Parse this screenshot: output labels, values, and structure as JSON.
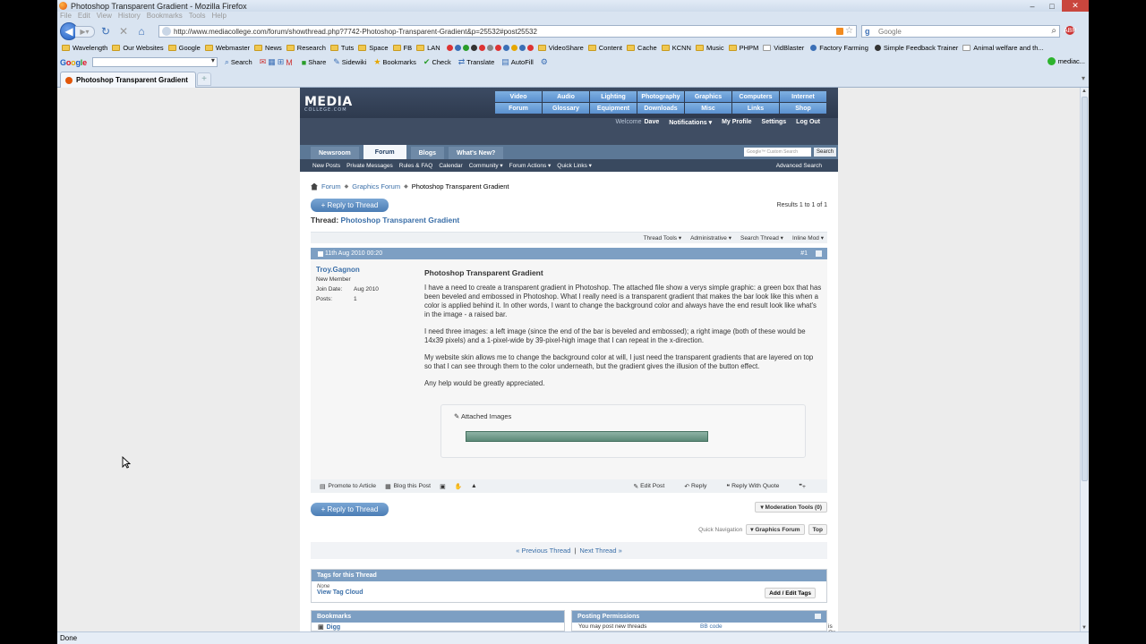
{
  "browser": {
    "window_title": "Photoshop Transparent Gradient - Mozilla Firefox",
    "menu": [
      "File",
      "Edit",
      "View",
      "History",
      "Bookmarks",
      "Tools",
      "Help"
    ],
    "url": "http://www.mediacollege.com/forum/showthread.php?7742-Photoshop-Transparent-Gradient&p=25532#post25532",
    "search_placeholder": "Google",
    "bookmarks": [
      "Wavelength",
      "Our Websites",
      "Google",
      "Webmaster",
      "News",
      "Research",
      "Tuts",
      "Space",
      "FB",
      "LAN",
      "VideoShare",
      "Content",
      "Cache",
      "KCNN",
      "Music",
      "PHPM",
      "VidBlaster",
      "Factory Farming",
      "Simple Feedback Trainer",
      "Animal welfare and th..."
    ],
    "google_toolbar": {
      "logo": [
        "G",
        "o",
        "o",
        "g",
        "l",
        "e"
      ],
      "items": [
        "Search",
        "Share",
        "Sidewiki",
        "Bookmarks",
        "Check",
        "Translate",
        "AutoFill"
      ],
      "right": "mediac..."
    },
    "tab_title": "Photoshop Transparent Gradient",
    "status": "Done"
  },
  "site": {
    "logo": "MEDIA",
    "logo_sub": "COLLEGE.COM",
    "nav_grid": [
      "Video",
      "Audio",
      "Lighting",
      "Photography",
      "Graphics",
      "Computers",
      "Internet",
      "Forum",
      "Glossary",
      "Equipment",
      "Downloads",
      "Misc",
      "Links",
      "Shop"
    ],
    "user_bar": {
      "welcome": "Welcome",
      "user": "Dave",
      "notifications": "Notifications ▾",
      "profile": "My Profile",
      "settings": "Settings",
      "logout": "Log Out"
    },
    "tabs": [
      "Newsroom",
      "Forum",
      "Blogs",
      "What's New?"
    ],
    "search_placeholder": "Google™ Custom Search",
    "search_btn": "Search",
    "subnav": [
      "New Posts",
      "Private Messages",
      "Rules & FAQ",
      "Calendar",
      "Community ▾",
      "Forum Actions ▾",
      "Quick Links ▾"
    ],
    "advanced_search": "Advanced Search"
  },
  "breadcrumb": {
    "forum": "Forum",
    "graphics": "Graphics Forum",
    "current": "Photoshop Transparent Gradient"
  },
  "reply_label": "+ Reply to Thread",
  "results": "Results 1 to 1 of 1",
  "thread": {
    "label": "Thread:",
    "title": "Photoshop Transparent Gradient"
  },
  "thread_tools": [
    "Thread Tools ▾",
    "Administrative ▾",
    "Search Thread ▾",
    "Inline Mod ▾"
  ],
  "post": {
    "date": "11th Aug 2010 00:20",
    "number": "#1",
    "username": "Troy.Gagnon",
    "rank": "New Member",
    "join_label": "Join Date:",
    "join_value": "Aug 2010",
    "posts_label": "Posts:",
    "posts_value": "1",
    "title": "Photoshop Transparent Gradient",
    "paragraphs": [
      "I have a need to create a transparent gradient in Photoshop. The attached file show a verys simple graphic: a green box that has been beveled and embossed in Photoshop. What I really need is a transparent gradient that makes the bar look like this when a color is applied behind it. In other words, I want to change the background color and always have the end result look like what's in the image - a raised bar.",
      "I need three images: a left image (since the end of the bar is beveled and embossed); a right image (both of these would be 14x39 pixels) and a 1-pixel-wide by 39-pixel-high image that I can repeat in the x-direction.",
      "My website skin allows me to change the background color at will, I just need the transparent gradients that are layered on top so that I can see through them to the color underneath, but the gradient gives the illusion of the button effect.",
      "Any help would be greatly appreciated."
    ],
    "attached": "Attached Images",
    "footer_left": [
      "Promote to Article",
      "Blog this Post"
    ],
    "footer_right": [
      "Edit Post",
      "Reply",
      "Reply With Quote"
    ]
  },
  "moderation": "▾ Moderation Tools (0)",
  "quick_nav": {
    "label": "Quick Navigation",
    "forum": "▾ Graphics Forum",
    "top": "Top"
  },
  "prevnext": {
    "prev": "« Previous Thread",
    "sep": "|",
    "next": "Next Thread »"
  },
  "tags": {
    "title": "Tags for this Thread",
    "none": "None",
    "cloud": "View Tag Cloud",
    "add": "Add / Edit Tags"
  },
  "bookmarks_box": {
    "title": "Bookmarks",
    "item": "Digg"
  },
  "permissions": {
    "title": "Posting Permissions",
    "row1": "You may post new threads",
    "bb": "BB code",
    "bb_state": "is On"
  }
}
